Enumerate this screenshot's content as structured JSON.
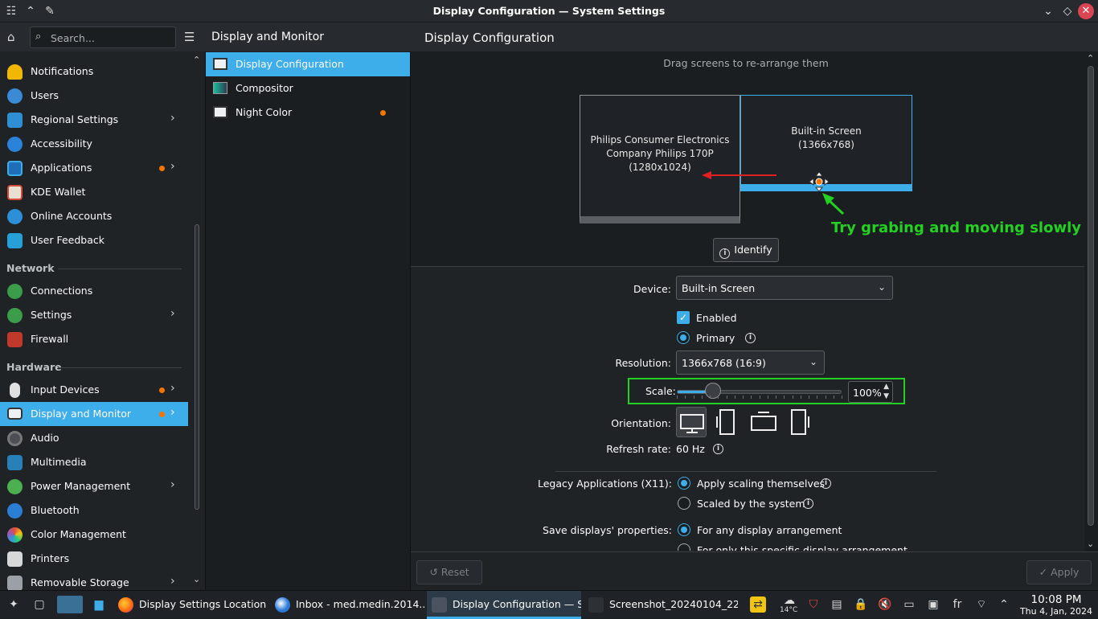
{
  "window": {
    "title": "Display Configuration — System Settings"
  },
  "sidebar": {
    "search_placeholder": "Search...",
    "sections": {
      "network": "Network",
      "hardware": "Hardware"
    },
    "items": [
      {
        "label": "Notifications",
        "icon": "bell-icon"
      },
      {
        "label": "Users",
        "icon": "users-icon"
      },
      {
        "label": "Regional Settings",
        "icon": "flag-icon"
      },
      {
        "label": "Accessibility",
        "icon": "accessibility-icon"
      },
      {
        "label": "Applications",
        "icon": "applications-icon"
      },
      {
        "label": "KDE Wallet",
        "icon": "wallet-icon"
      },
      {
        "label": "Online Accounts",
        "icon": "globe-icon"
      },
      {
        "label": "User Feedback",
        "icon": "feedback-icon"
      },
      {
        "label": "Connections",
        "icon": "globe-icon"
      },
      {
        "label": "Settings",
        "icon": "globe-icon"
      },
      {
        "label": "Firewall",
        "icon": "firewall-icon"
      },
      {
        "label": "Input Devices",
        "icon": "mouse-icon"
      },
      {
        "label": "Display and Monitor",
        "icon": "monitor-icon"
      },
      {
        "label": "Audio",
        "icon": "speaker-icon"
      },
      {
        "label": "Multimedia",
        "icon": "multimedia-icon"
      },
      {
        "label": "Power Management",
        "icon": "power-icon"
      },
      {
        "label": "Bluetooth",
        "icon": "bluetooth-icon"
      },
      {
        "label": "Color Management",
        "icon": "color-icon"
      },
      {
        "label": "Printers",
        "icon": "printer-icon"
      },
      {
        "label": "Removable Storage",
        "icon": "storage-icon"
      }
    ]
  },
  "subpanel": {
    "title": "Display and Monitor",
    "items": [
      {
        "label": "Display Configuration"
      },
      {
        "label": "Compositor"
      },
      {
        "label": "Night Color"
      }
    ]
  },
  "main": {
    "title": "Display Configuration",
    "arrange_hint": "Drag screens to re-arrange them",
    "screens": {
      "philips": {
        "line1": "Philips Consumer Electronics",
        "line2": "Company Philips 170P",
        "line3": "(1280x1024)"
      },
      "builtin": {
        "line1": "Built-in Screen",
        "line2": "(1366x768)"
      }
    },
    "identify_label": "Identify",
    "annotation": "Try grabing and moving slowly",
    "device": {
      "label": "Device:",
      "value": "Built-in Screen"
    },
    "enabled_label": "Enabled",
    "primary_label": "Primary",
    "resolution": {
      "label": "Resolution:",
      "value": "1366x768 (16:9)"
    },
    "scale": {
      "label": "Scale:",
      "value": "100%",
      "fraction": 0.22
    },
    "orientation_label": "Orientation:",
    "refresh": {
      "label": "Refresh rate:",
      "value": "60 Hz"
    },
    "legacy": {
      "label": "Legacy Applications (X11):",
      "opt1": "Apply scaling themselves",
      "opt2": "Scaled by the system"
    },
    "save": {
      "label": "Save displays' properties:",
      "opt1": "For any display arrangement",
      "opt2": "For only this specific display arrangement"
    },
    "reset_label": "Reset",
    "apply_label": "Apply"
  },
  "taskbar": {
    "tasks": [
      {
        "label": "Display Settings Location ..."
      },
      {
        "label": "Inbox - med.medin.2014..."
      },
      {
        "label": "Display Configuration — S..."
      },
      {
        "label": "Screenshot_20240104_22..."
      }
    ],
    "weather_temp": "14°C",
    "keyboard_layout": "fr",
    "time": "10:08 PM",
    "date": "Thu 4, Jan, 2024"
  },
  "colors": {
    "accent": "#3daee9",
    "badge": "#f67400",
    "annotation": "#23d023",
    "arrow": "#e02020"
  }
}
